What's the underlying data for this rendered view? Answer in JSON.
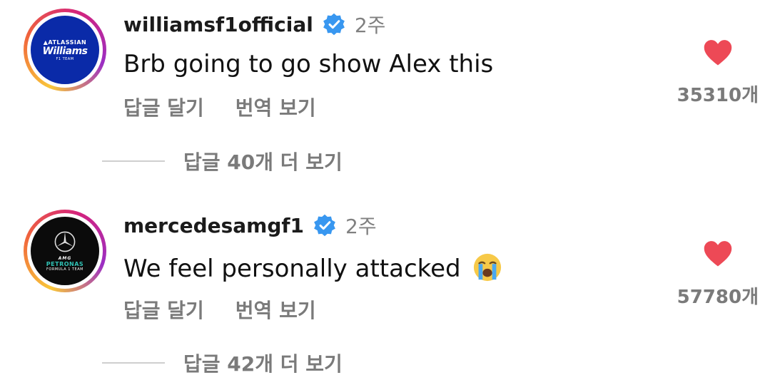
{
  "comments": [
    {
      "username": "williamsf1official",
      "time": "2주",
      "text": "Brb going to go show Alex this",
      "reply_label": "답글 달기",
      "translate_label": "번역 보기",
      "likes": "35310개",
      "view_replies": "답글 40개 더 보기",
      "avatar": {
        "line1": "▲ATLASSIAN",
        "line2": "Williams",
        "line3": "F1 TEAM",
        "color": "#0a2aa8"
      }
    },
    {
      "username": "mercedesamgf1",
      "time": "2주",
      "text": "We feel personally attacked",
      "reply_label": "답글 달기",
      "translate_label": "번역 보기",
      "likes": "57780개",
      "view_replies": "답글 42개 더 보기",
      "avatar": {
        "line1": "AMG",
        "line2": "PETRONAS",
        "line3": "FORMULA 1 TEAM",
        "color": "#0b0b0b"
      }
    }
  ],
  "icons": {
    "verified": "verified-badge-icon",
    "like": "heart-icon",
    "emoji": "loudly-crying-face-emoji"
  },
  "colors": {
    "verified": "#3897f0",
    "heart": "#ed4956",
    "muted": "#7a7a7a"
  }
}
